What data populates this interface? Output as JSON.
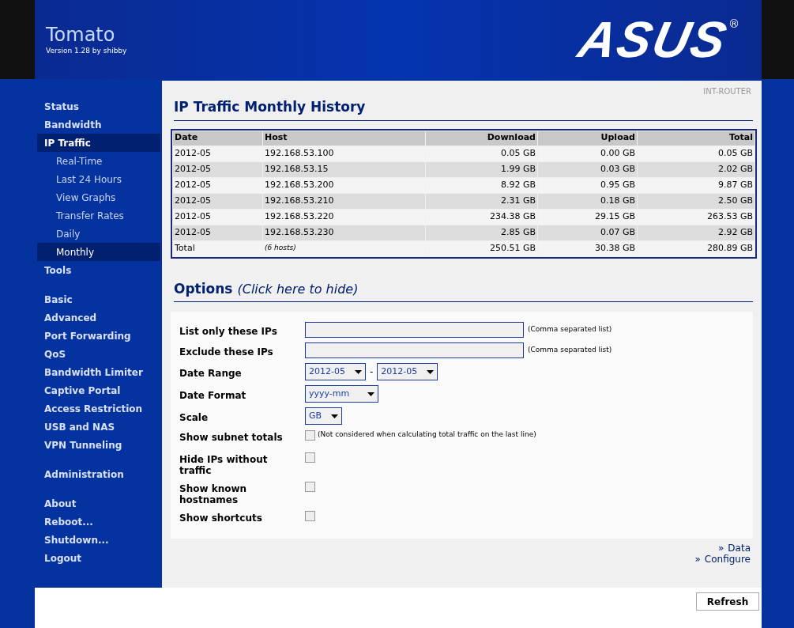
{
  "header": {
    "title": "Tomato",
    "version": "Version 1.28 by shibby",
    "logo": "ASUS",
    "logo_mark": "®"
  },
  "sidebar": {
    "groups": [
      [
        {
          "label": "Status",
          "selected": false
        },
        {
          "label": "Bandwidth",
          "selected": false
        },
        {
          "label": "IP Traffic",
          "selected": true,
          "children": [
            {
              "label": "Real-Time",
              "selected": false
            },
            {
              "label": "Last 24 Hours",
              "selected": false
            },
            {
              "label": "View Graphs",
              "selected": false
            },
            {
              "label": "Transfer Rates",
              "selected": false
            },
            {
              "label": "Daily",
              "selected": false
            },
            {
              "label": "Monthly",
              "selected": true
            }
          ]
        },
        {
          "label": "Tools",
          "selected": false
        }
      ],
      [
        {
          "label": "Basic",
          "selected": false
        },
        {
          "label": "Advanced",
          "selected": false
        },
        {
          "label": "Port Forwarding",
          "selected": false
        },
        {
          "label": "QoS",
          "selected": false
        },
        {
          "label": "Bandwidth Limiter",
          "selected": false
        },
        {
          "label": "Captive Portal",
          "selected": false
        },
        {
          "label": "Access Restriction",
          "selected": false
        },
        {
          "label": "USB and NAS",
          "selected": false
        },
        {
          "label": "VPN Tunneling",
          "selected": false
        }
      ],
      [
        {
          "label": "Administration",
          "selected": false
        }
      ],
      [
        {
          "label": "About",
          "selected": false
        },
        {
          "label": "Reboot...",
          "selected": false
        },
        {
          "label": "Shutdown...",
          "selected": false
        },
        {
          "label": "Logout",
          "selected": false
        }
      ]
    ]
  },
  "router_name": "INT-ROUTER",
  "page_title": "IP Traffic Monthly History",
  "table": {
    "columns": [
      "Date",
      "Host",
      "Download",
      "Upload",
      "Total"
    ],
    "rows": [
      [
        "2012-05",
        "192.168.53.100",
        "0.05 GB",
        "0.00 GB",
        "0.05 GB"
      ],
      [
        "2012-05",
        "192.168.53.15",
        "1.99 GB",
        "0.03 GB",
        "2.02 GB"
      ],
      [
        "2012-05",
        "192.168.53.200",
        "8.92 GB",
        "0.95 GB",
        "9.87 GB"
      ],
      [
        "2012-05",
        "192.168.53.210",
        "2.31 GB",
        "0.18 GB",
        "2.50 GB"
      ],
      [
        "2012-05",
        "192.168.53.220",
        "234.38 GB",
        "29.15 GB",
        "263.53 GB"
      ],
      [
        "2012-05",
        "192.168.53.230",
        "2.85 GB",
        "0.07 GB",
        "2.92 GB"
      ]
    ],
    "total": [
      "Total",
      "(6 hosts)",
      "250.51 GB",
      "30.38 GB",
      "280.89 GB"
    ]
  },
  "options": {
    "title": "Options",
    "toggle": "(Click here to hide)",
    "rows": [
      {
        "kind": "text",
        "label": "List only these IPs",
        "value": "",
        "note": "(Comma separated list)"
      },
      {
        "kind": "text",
        "label": "Exclude these IPs",
        "value": "",
        "note": "(Comma separated list)"
      },
      {
        "kind": "range",
        "label": "Date Range",
        "from": "2012-05",
        "separator": "-",
        "to": "2012-05"
      },
      {
        "kind": "select",
        "label": "Date Format",
        "value": "yyyy-mm"
      },
      {
        "kind": "select",
        "label": "Scale",
        "value": "GB"
      },
      {
        "kind": "checkbox",
        "label": "Show subnet totals",
        "checked": false,
        "note": "(Not considered when calculating total traffic on the last line)"
      },
      {
        "kind": "checkbox",
        "label": "Hide IPs without traffic",
        "checked": false
      },
      {
        "kind": "checkbox",
        "label": "Show known hostnames",
        "checked": false
      },
      {
        "kind": "checkbox",
        "label": "Show shortcuts",
        "checked": false
      }
    ]
  },
  "links": [
    {
      "marker": "»",
      "label": "Data"
    },
    {
      "marker": "»",
      "label": "Configure"
    }
  ],
  "refresh_button": "Refresh"
}
